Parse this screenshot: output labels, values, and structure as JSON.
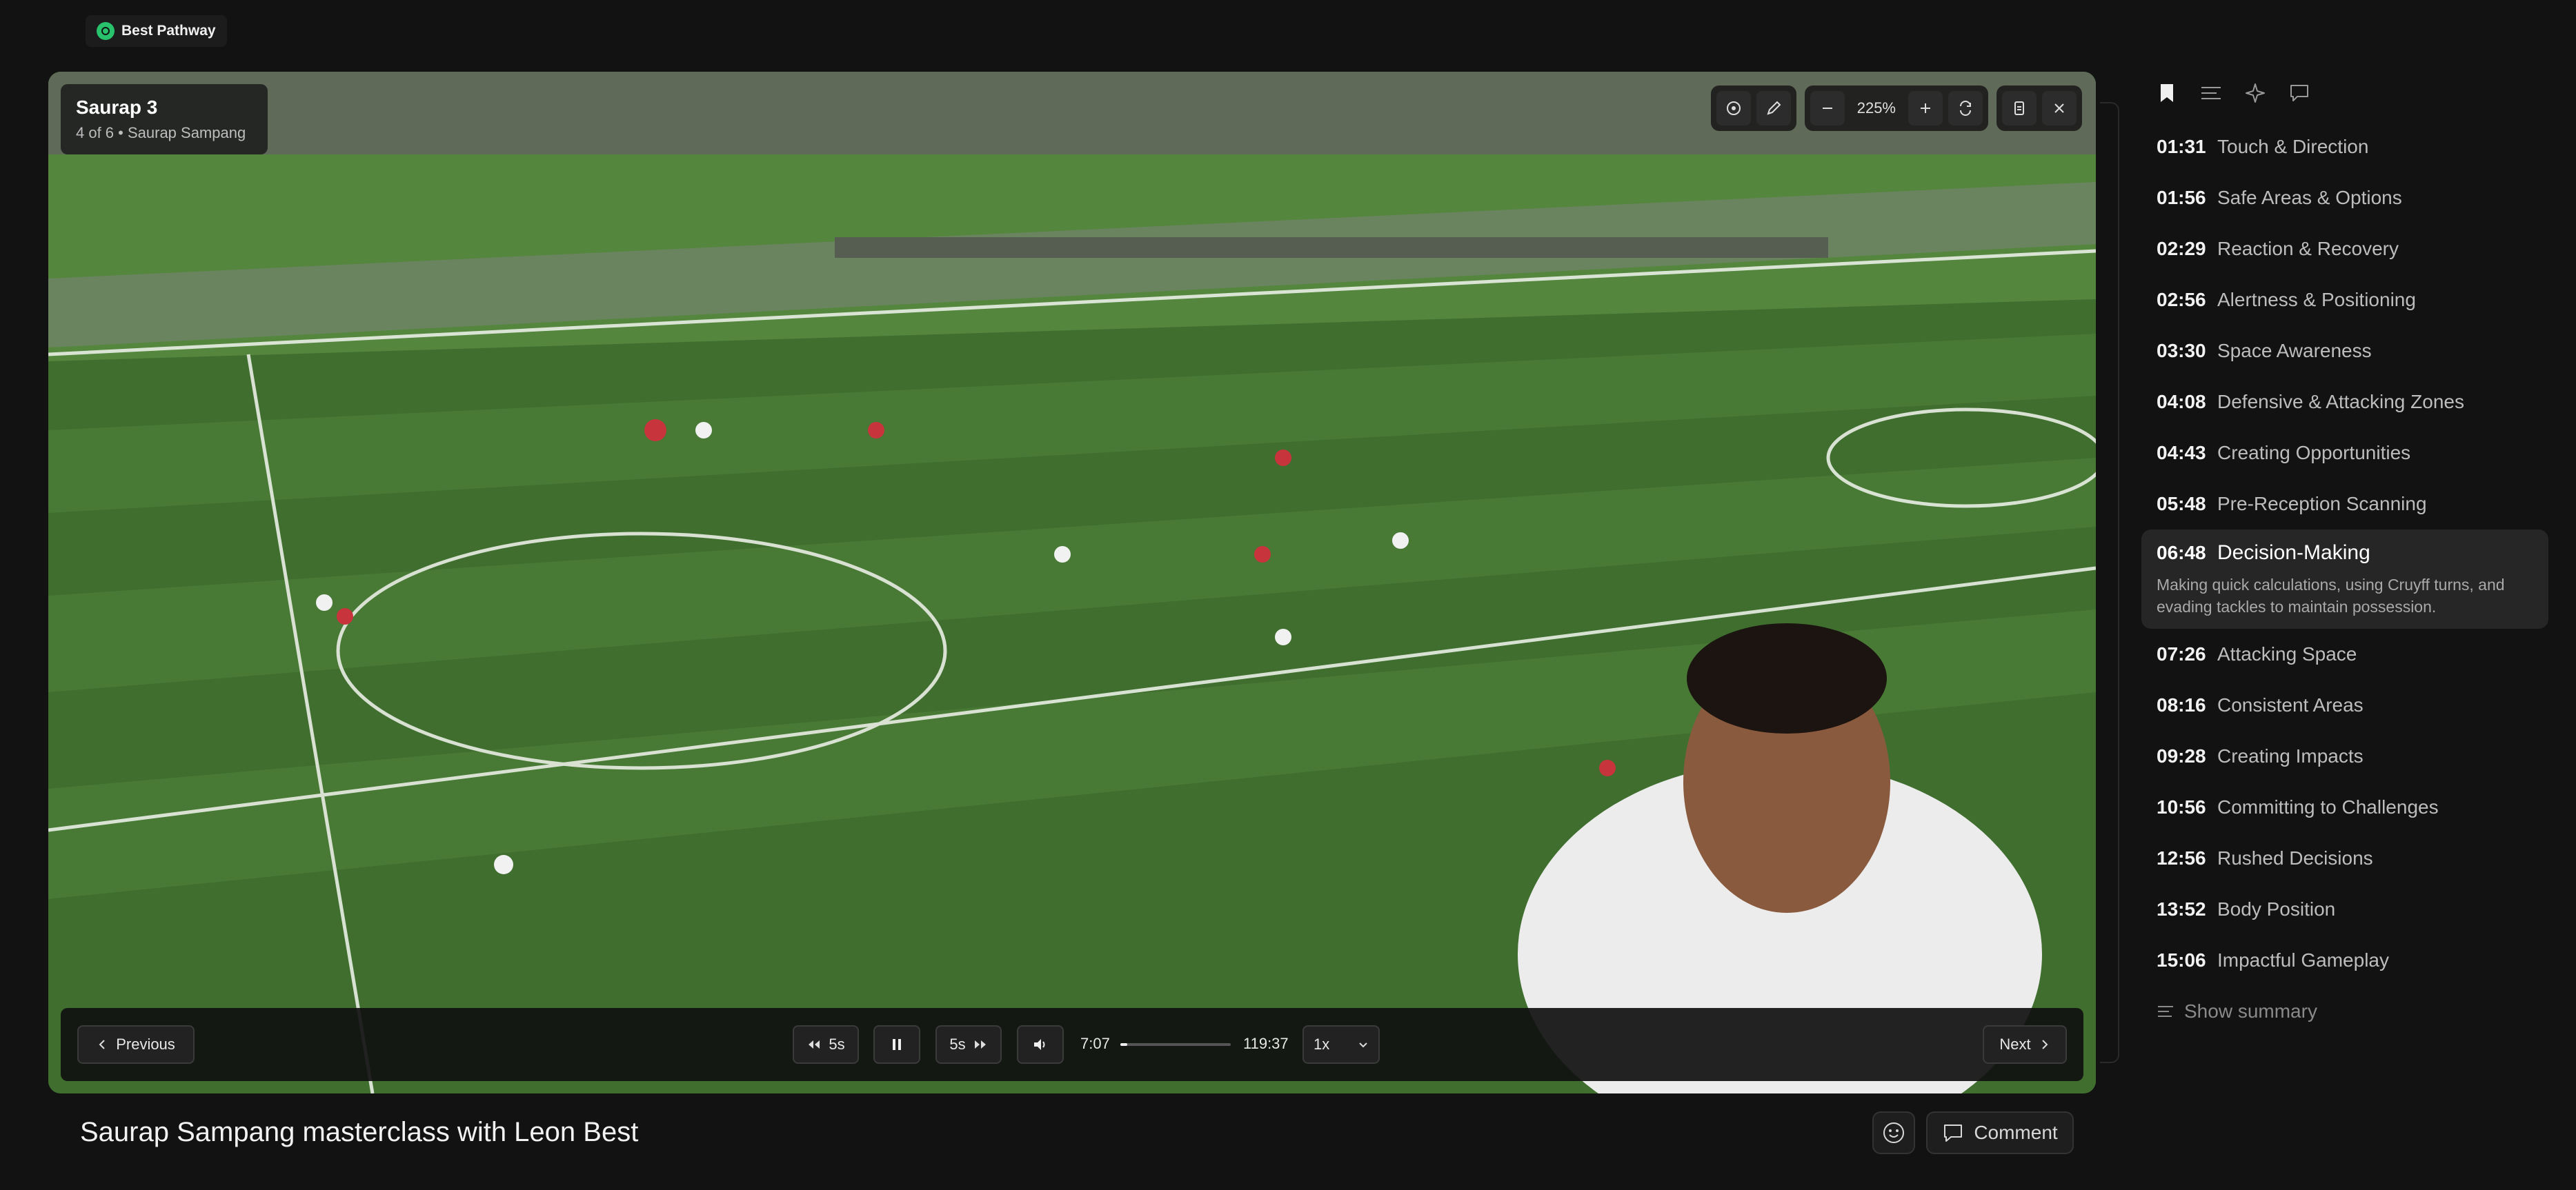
{
  "brand": {
    "name": "Best Pathway",
    "logo_color": "#27c26b"
  },
  "clip": {
    "title": "Saurap 3",
    "subtitle": "4 of 6 • Saurap Sampang"
  },
  "toolbar": {
    "zoom": "225%",
    "icons": [
      "target-icon",
      "pen-icon",
      "minus-icon",
      "plus-icon",
      "rotate-icon",
      "document-icon",
      "close-icon"
    ]
  },
  "controls": {
    "previous_label": "Previous",
    "next_label": "Next",
    "back_label": "5s",
    "forward_label": "5s",
    "current_time": "7:07",
    "total_time": "119:37",
    "progress": 0.06,
    "speed": "1x"
  },
  "video": {
    "title": "Saurap Sampang masterclass with Leon Best"
  },
  "actions": {
    "comment_label": "Comment"
  },
  "sidebar": {
    "tabs": [
      "bookmark-icon",
      "list-icon",
      "sparkle-icon",
      "chat-icon"
    ],
    "chapters": [
      {
        "time": "01:31",
        "label": "Touch & Direction"
      },
      {
        "time": "01:56",
        "label": "Safe Areas & Options"
      },
      {
        "time": "02:29",
        "label": "Reaction & Recovery"
      },
      {
        "time": "02:56",
        "label": "Alertness & Positioning"
      },
      {
        "time": "03:30",
        "label": "Space Awareness"
      },
      {
        "time": "04:08",
        "label": "Defensive & Attacking Zones"
      },
      {
        "time": "04:43",
        "label": "Creating Opportunities"
      },
      {
        "time": "05:48",
        "label": "Pre-Reception Scanning"
      },
      {
        "time": "06:48",
        "label": "Decision-Making",
        "desc": "Making quick calculations, using Cruyff turns, and evading tackles to maintain possession."
      },
      {
        "time": "07:26",
        "label": "Attacking Space"
      },
      {
        "time": "08:16",
        "label": "Consistent Areas"
      },
      {
        "time": "09:28",
        "label": "Creating Impacts"
      },
      {
        "time": "10:56",
        "label": "Committing to Challenges"
      },
      {
        "time": "12:56",
        "label": "Rushed Decisions"
      },
      {
        "time": "13:52",
        "label": "Body Position"
      },
      {
        "time": "15:06",
        "label": "Impactful Gameplay"
      }
    ],
    "show_summary": "Show summary"
  }
}
